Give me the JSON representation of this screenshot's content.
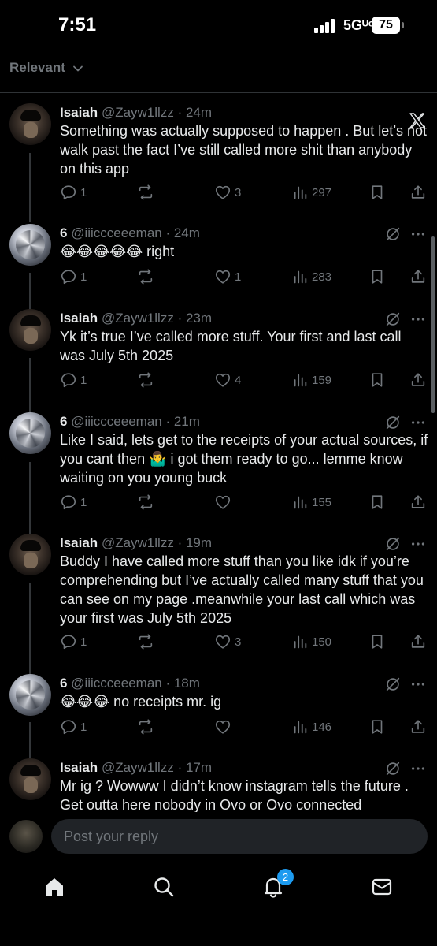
{
  "status_bar": {
    "time": "7:51",
    "network": "5Gᵁᶜ",
    "battery": "75"
  },
  "sort": {
    "label": "Relevant"
  },
  "reply_bar": {
    "placeholder": "Post your reply"
  },
  "tab_bar": {
    "notification_count": "2"
  },
  "tweets": [
    {
      "name": "Isaiah",
      "handle": "@Zayw1llzz",
      "time": "· 24m",
      "text": "Something was actually supposed to happen . But let’s not walk past the fact I’ve still called more shit than anybody on this app",
      "replies": "1",
      "retweets": "",
      "likes": "3",
      "views": "297"
    },
    {
      "name": "6",
      "handle": "@iiiccceeeman",
      "time": "· 24m",
      "text": "😂😂😂😂😂 right",
      "replies": "1",
      "retweets": "",
      "likes": "1",
      "views": "283"
    },
    {
      "name": "Isaiah",
      "handle": "@Zayw1llzz",
      "time": "· 23m",
      "text": "Yk it’s true I’ve called more stuff. Your first and last call was July 5th 2025",
      "replies": "1",
      "retweets": "",
      "likes": "4",
      "views": "159"
    },
    {
      "name": "6",
      "handle": "@iiiccceeeman",
      "time": "· 21m",
      "text": "Like I said, lets get to the receipts of your actual sources, if you cant then 🤷‍♂️ i got them ready to go... lemme know waiting on you young buck",
      "replies": "1",
      "retweets": "",
      "likes": "",
      "views": "155"
    },
    {
      "name": "Isaiah",
      "handle": "@Zayw1llzz",
      "time": "· 19m",
      "text": "Buddy I have called more stuff than you like idk if you’re comprehending but I’ve actually called many stuff that you can see on my page .meanwhile your last call which was your first was July 5th 2025",
      "replies": "1",
      "retweets": "",
      "likes": "3",
      "views": "150"
    },
    {
      "name": "6",
      "handle": "@iiiccceeeman",
      "time": "· 18m",
      "text": "😂😂😂 no receipts mr. ig",
      "replies": "1",
      "retweets": "",
      "likes": "",
      "views": "146"
    },
    {
      "name": "Isaiah",
      "handle": "@Zayw1llzz",
      "time": "· 17m",
      "text": "Mr ig ? Wowww I didn’t know instagram tells the future . Get outta here nobody in Ovo or Ovo connected",
      "replies": "",
      "retweets": "",
      "likes": "",
      "views": ""
    }
  ]
}
